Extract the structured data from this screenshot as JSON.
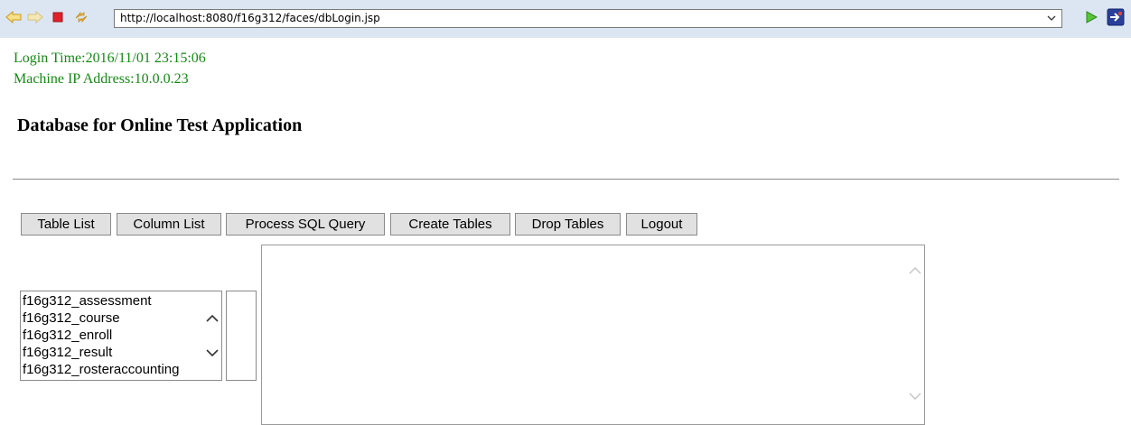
{
  "browser": {
    "url": "http://localhost:8080/f16g312/faces/dbLogin.jsp",
    "icons": [
      "back-arrow-icon",
      "forward-arrow-icon",
      "stop-icon",
      "refresh-icon",
      "url-dropdown-icon",
      "go-icon",
      "launch-browser-icon"
    ]
  },
  "page": {
    "login_time": "Login Time:2016/11/01 23:15:06",
    "machine_ip": "Machine IP Address:10.0.0.23",
    "heading": "Database for Online Test Application",
    "meta_color": "#148a14"
  },
  "buttons": {
    "table_list": "Table List",
    "column_list": "Column List",
    "process_sql": "Process SQL Query",
    "create_tables": "Create Tables",
    "drop_tables": "Drop Tables",
    "logout": "Logout"
  },
  "table_list": {
    "items": [
      "f16g312_assessment",
      "f16g312_course",
      "f16g312_enroll",
      "f16g312_result",
      "f16g312_rosteraccounting"
    ]
  },
  "query_area": {
    "value": ""
  }
}
